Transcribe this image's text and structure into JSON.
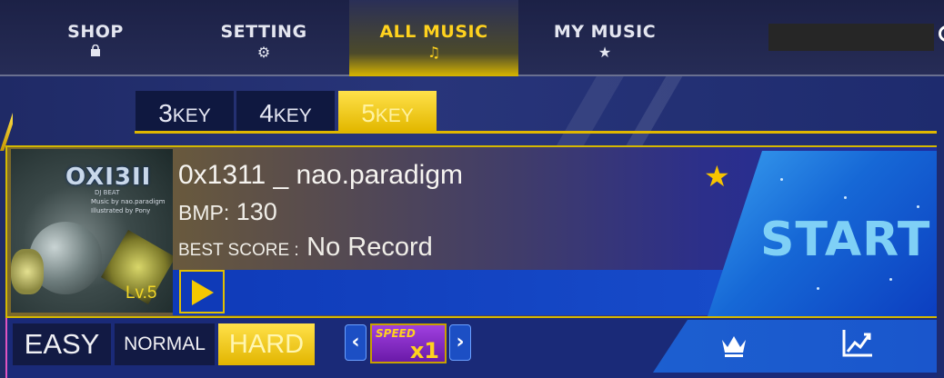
{
  "nav": {
    "tabs": [
      {
        "label": "SHOP",
        "icon": "shopping-bag-icon"
      },
      {
        "label": "SETTING",
        "icon": "gear-icon"
      },
      {
        "label": "ALL MUSIC",
        "icon": "music-note-icon"
      },
      {
        "label": "MY MUSIC",
        "icon": "star-icon"
      }
    ],
    "active": "ALL MUSIC"
  },
  "key_modes": [
    {
      "num": "3",
      "label": "KEY"
    },
    {
      "num": "4",
      "label": "KEY"
    },
    {
      "num": "5",
      "label": "KEY"
    }
  ],
  "selected_key_mode": "5KEY",
  "song": {
    "title": "0x1311 _ nao.paradigm",
    "bmp_label": "BMP:",
    "bmp_value": "130",
    "best_score_label": "BEST SCORE :",
    "best_score_value": "No Record",
    "favorite": true,
    "jacket": {
      "title": "OXI3II",
      "subtitle": "DJ BEAT",
      "credit_music": "Music by nao.paradigm",
      "credit_illust": "Illustrated by Pony",
      "level": "Lv.5"
    }
  },
  "start_label": "START",
  "difficulties": [
    "EASY",
    "NORMAL",
    "HARD"
  ],
  "selected_difficulty": "HARD",
  "speed": {
    "label": "SPEED",
    "value": "x1"
  },
  "colors": {
    "accent_gold": "#ffd21e",
    "start_blue": "#1668d6",
    "start_text": "#7fd0f6",
    "background": "#28357a"
  }
}
